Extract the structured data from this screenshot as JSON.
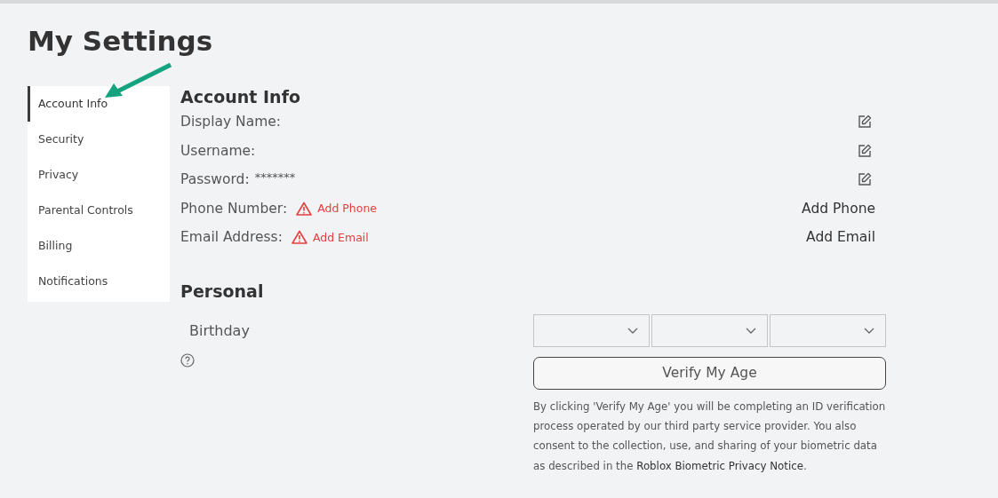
{
  "page": {
    "title": "My Settings"
  },
  "sidebar": {
    "items": [
      {
        "label": "Account Info",
        "selected": true
      },
      {
        "label": "Security",
        "selected": false
      },
      {
        "label": "Privacy",
        "selected": false
      },
      {
        "label": "Parental Controls",
        "selected": false
      },
      {
        "label": "Billing",
        "selected": false
      },
      {
        "label": "Notifications",
        "selected": false
      }
    ]
  },
  "account_info": {
    "heading": "Account Info",
    "rows": [
      {
        "kind": "edit",
        "label": "Display Name:"
      },
      {
        "kind": "edit",
        "label": "Username:"
      },
      {
        "kind": "edit",
        "label": "Password:",
        "value": "*******"
      },
      {
        "kind": "add",
        "label": "Phone Number:",
        "warning": "Add Phone",
        "action": "Add Phone"
      },
      {
        "kind": "add",
        "label": "Email Address:",
        "warning": "Add Email",
        "action": "Add Email"
      }
    ]
  },
  "personal": {
    "heading": "Personal",
    "birthday_label": "Birthday",
    "dropdowns": [
      {
        "kind": "select"
      },
      {
        "kind": "select"
      },
      {
        "kind": "select"
      }
    ],
    "verify_button": "Verify My Age",
    "notice": "By clicking 'Verify My Age' you will be completing an ID verification process operated by our third party service provider. You also consent to the collection, use, and sharing of your biometric data as described in the",
    "notice_link": "Roblox Biometric Privacy Notice",
    "notice_end": "."
  }
}
